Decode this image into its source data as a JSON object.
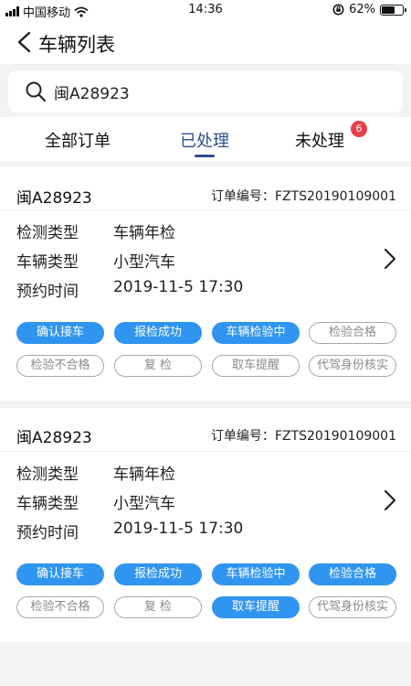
{
  "status_bar": {
    "carrier": "中国移动",
    "time": "14:36",
    "battery": "62%",
    "battery_level": 0.62
  },
  "nav": {
    "title": "车辆列表"
  },
  "search": {
    "value": "闽A28923"
  },
  "tabs": [
    {
      "label": "全部订单",
      "active": false
    },
    {
      "label": "已处理",
      "active": true
    },
    {
      "label": "未处理",
      "active": false,
      "badge": "6"
    }
  ],
  "orders": [
    {
      "plate": "闽A28923",
      "order_label": "订单编号：",
      "order_no": "FZTS20190109001",
      "fields": [
        {
          "label": "检测类型",
          "value": "车辆年检"
        },
        {
          "label": "车辆类型",
          "value": "小型汽车"
        },
        {
          "label": "预约时间",
          "value": "2019-11-5  17:30"
        }
      ],
      "steps": [
        {
          "label": "确认接车",
          "on": true
        },
        {
          "label": "报检成功",
          "on": true
        },
        {
          "label": "车辆检验中",
          "on": true
        },
        {
          "label": "检验合格",
          "on": false
        },
        {
          "label": "检验不合格",
          "on": false
        },
        {
          "label": "复  检",
          "on": false
        },
        {
          "label": "取车提醒",
          "on": false
        },
        {
          "label": "代驾身份核实",
          "on": false
        }
      ]
    },
    {
      "plate": "闽A28923",
      "order_label": "订单编号：",
      "order_no": "FZTS20190109001",
      "fields": [
        {
          "label": "检测类型",
          "value": "车辆年检"
        },
        {
          "label": "车辆类型",
          "value": "小型汽车"
        },
        {
          "label": "预约时间",
          "value": "2019-11-5  17:30"
        }
      ],
      "steps": [
        {
          "label": "确认接车",
          "on": true
        },
        {
          "label": "报检成功",
          "on": true
        },
        {
          "label": "车辆检验中",
          "on": true
        },
        {
          "label": "检验合格",
          "on": true
        },
        {
          "label": "检验不合格",
          "on": false
        },
        {
          "label": "复  检",
          "on": false
        },
        {
          "label": "取车提醒",
          "on": true
        },
        {
          "label": "代驾身份核实",
          "on": false
        }
      ]
    }
  ],
  "colors": {
    "accent": "#2f95f0",
    "tab_active": "#2d4e8d",
    "badge": "#e8404a",
    "inactive_pill": "#a8a8a8"
  }
}
